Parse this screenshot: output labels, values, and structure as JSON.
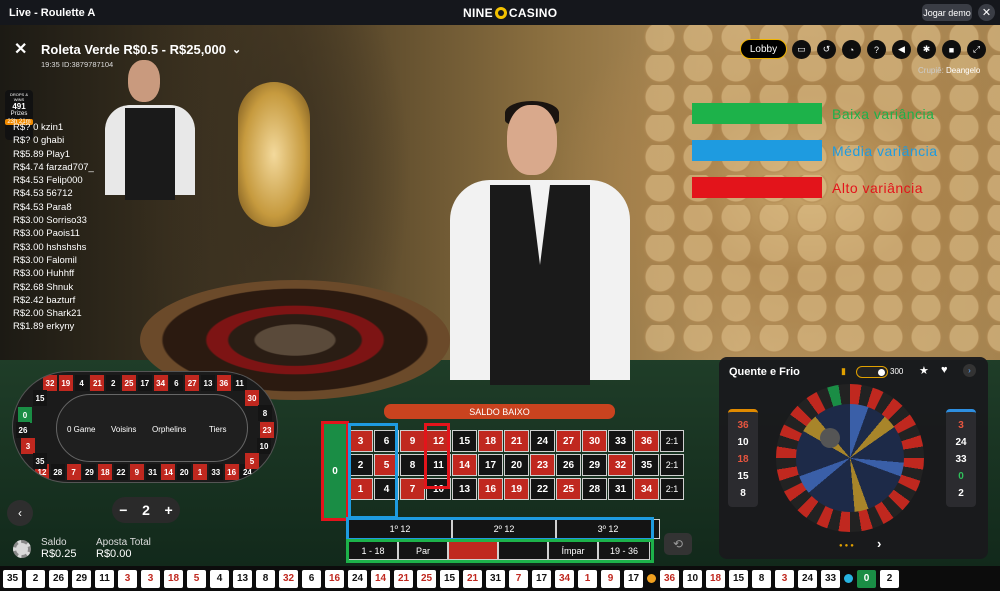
{
  "topbar": {
    "title": "Live - Roulette A",
    "logo_left": "NINE",
    "logo_right": "CASINO",
    "demo_label": "Jogar demo",
    "close": "✕"
  },
  "game": {
    "title": "Roleta Verde R$0.5 - R$25,000",
    "chevron": "⌄",
    "time": "19:35",
    "id": "ID:3879787104",
    "lobby": "Lobby",
    "croupier_label": "Crupiê:",
    "croupier_name": "Deangelo"
  },
  "toolbar_icons": [
    "chat-icon",
    "history-icon",
    "timer-icon",
    "help-icon",
    "volume-icon",
    "settings-icon",
    "camera-icon",
    "fullscreen-icon"
  ],
  "drops": {
    "label": "DROPS & WINS",
    "count": "491",
    "unit": "Prizes",
    "timer": "23h 21m"
  },
  "winners": [
    "R$? 0 kzin1",
    "R$? 0 ghabi",
    "R$5.89 Play1",
    "R$4.74 farzad707_",
    "R$4.53 Felip000",
    "R$4.53 56712",
    "R$4.53 Para8",
    "R$3.00 Sorriso33",
    "R$3.00 Paois11",
    "R$3.00 hshshshs",
    "R$3.00 Falomil",
    "R$3.00 Huhhff",
    "R$2.68 Shnuk",
    "R$2.42 bazturf",
    "R$2.00 Shark21",
    "R$1.89 erkyny"
  ],
  "legend": [
    {
      "color": "#1db24a",
      "label": "Baixa variância",
      "text_color": "#1db24a"
    },
    {
      "color": "#1e9be0",
      "label": "Média variância",
      "text_color": "#1e9be0"
    },
    {
      "color": "#e3141b",
      "label": "Alto variância",
      "text_color": "#e3141b"
    }
  ],
  "racetrack": {
    "zero_game": "0 Game",
    "voisins": "Voisins",
    "orphelins": "Orphelins",
    "tiers": "Tiers",
    "top": [
      "32",
      "19",
      "4",
      "21",
      "2",
      "25",
      "17",
      "34",
      "6",
      "27",
      "13",
      "36",
      "11"
    ],
    "bottom": [
      "12",
      "28",
      "7",
      "29",
      "18",
      "22",
      "9",
      "31",
      "14",
      "20",
      "1",
      "33",
      "16",
      "24"
    ],
    "left": [
      "15",
      "0",
      "26",
      "3",
      "35"
    ],
    "right": [
      "30",
      "8",
      "23",
      "10",
      "5"
    ]
  },
  "stepper": {
    "minus": "−",
    "value": "2",
    "plus": "+"
  },
  "balance": {
    "saldo_label": "Saldo",
    "saldo_value": "R$0.25",
    "aposta_label": "Aposta Total",
    "aposta_value": "R$0.00"
  },
  "banner": "SALDO BAIXO",
  "table": {
    "zero": "0",
    "rows": [
      [
        [
          "3",
          "r"
        ],
        [
          "6",
          "b"
        ],
        [
          "9",
          "r"
        ],
        [
          "12",
          "r"
        ],
        [
          "15",
          "b"
        ],
        [
          "18",
          "r"
        ],
        [
          "21",
          "r"
        ],
        [
          "24",
          "b"
        ],
        [
          "27",
          "r"
        ],
        [
          "30",
          "r"
        ],
        [
          "33",
          "b"
        ],
        [
          "36",
          "r"
        ]
      ],
      [
        [
          "2",
          "b"
        ],
        [
          "5",
          "r"
        ],
        [
          "8",
          "b"
        ],
        [
          "11",
          "b"
        ],
        [
          "14",
          "r"
        ],
        [
          "17",
          "b"
        ],
        [
          "20",
          "b"
        ],
        [
          "23",
          "r"
        ],
        [
          "26",
          "b"
        ],
        [
          "29",
          "b"
        ],
        [
          "32",
          "r"
        ],
        [
          "35",
          "b"
        ]
      ],
      [
        [
          "1",
          "r"
        ],
        [
          "4",
          "b"
        ],
        [
          "7",
          "r"
        ],
        [
          "10",
          "b"
        ],
        [
          "13",
          "b"
        ],
        [
          "16",
          "r"
        ],
        [
          "19",
          "r"
        ],
        [
          "22",
          "b"
        ],
        [
          "25",
          "r"
        ],
        [
          "28",
          "b"
        ],
        [
          "31",
          "b"
        ],
        [
          "34",
          "r"
        ]
      ]
    ],
    "col": "2:1",
    "dozens": [
      "1º 12",
      "2º 12",
      "3º 12"
    ],
    "outside": [
      "1 - 18",
      "Par",
      "",
      "",
      "Ímpar",
      "19 - 36"
    ]
  },
  "hot_cold": {
    "title": "Quente e Frio",
    "count": "300",
    "hot": [
      [
        "36",
        "r"
      ],
      [
        "10",
        "b"
      ],
      [
        "18",
        "r"
      ],
      [
        "15",
        "b"
      ],
      [
        "8",
        "b"
      ]
    ],
    "cold": [
      [
        "3",
        "r"
      ],
      [
        "24",
        "b"
      ],
      [
        "33",
        "b"
      ],
      [
        "0",
        "g"
      ],
      [
        "2",
        "b"
      ]
    ]
  },
  "history": [
    [
      "35",
      "b"
    ],
    [
      "2",
      "b"
    ],
    [
      "26",
      "b"
    ],
    [
      "29",
      "b"
    ],
    [
      "11",
      "b"
    ],
    [
      "3",
      "r"
    ],
    [
      "3",
      "r"
    ],
    [
      "18",
      "r"
    ],
    [
      "5",
      "r"
    ],
    [
      "4",
      "b"
    ],
    [
      "13",
      "b"
    ],
    [
      "8",
      "b"
    ],
    [
      "32",
      "r"
    ],
    [
      "6",
      "b"
    ],
    [
      "16",
      "r"
    ],
    [
      "24",
      "b"
    ],
    [
      "14",
      "r"
    ],
    [
      "21",
      "r"
    ],
    [
      "25",
      "r"
    ],
    [
      "15",
      "b"
    ],
    [
      "21",
      "r"
    ],
    [
      "31",
      "b"
    ],
    [
      "7",
      "r"
    ],
    [
      "17",
      "b"
    ],
    [
      "34",
      "r"
    ],
    [
      "1",
      "r"
    ],
    [
      "9",
      "r"
    ],
    [
      "17",
      "b"
    ],
    [
      "36",
      "r"
    ],
    [
      "10",
      "b"
    ],
    [
      "18",
      "r"
    ],
    [
      "15",
      "b"
    ],
    [
      "8",
      "b"
    ],
    [
      "3",
      "r"
    ],
    [
      "24",
      "b"
    ],
    [
      "33",
      "b"
    ],
    [
      "0",
      "g"
    ],
    [
      "2",
      "b"
    ]
  ],
  "colors": {
    "red": "#c0281f",
    "black": "#141414",
    "green": "#1a8d45",
    "accent": "#f0b400"
  }
}
